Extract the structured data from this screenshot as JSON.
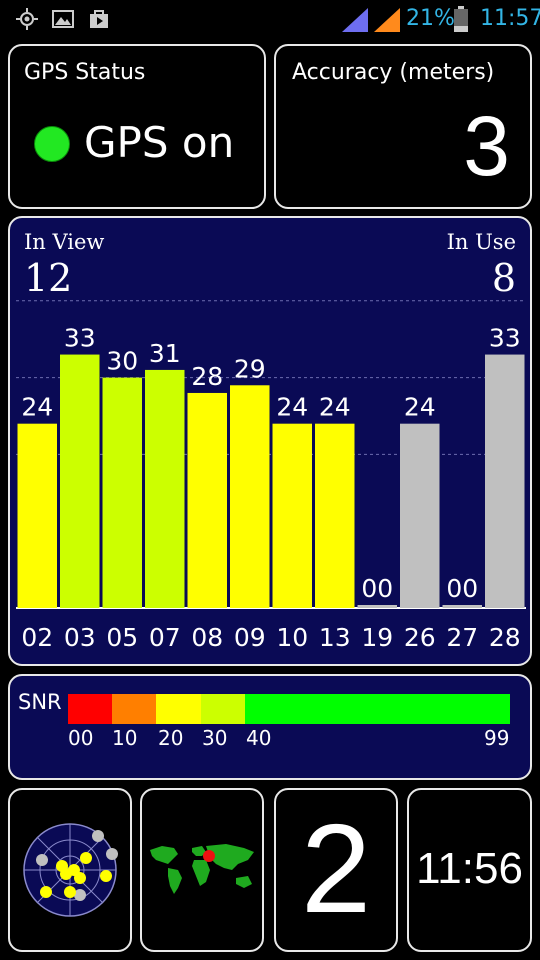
{
  "status_bar": {
    "battery_percent": "21%",
    "time": "11:57",
    "icons": [
      "gps-target-icon",
      "image-icon",
      "shopping-bag-icon",
      "signal-bars-icon",
      "signal-bars-icon",
      "battery-icon"
    ],
    "accent_color": "#33b5e5"
  },
  "gps_status": {
    "title": "GPS Status",
    "state": "GPS on",
    "indicator_color": "#22e822"
  },
  "accuracy": {
    "title": "Accuracy (meters)",
    "value": "3"
  },
  "satellites": {
    "in_view_label": "In View",
    "in_view_value": "12",
    "in_use_label": "In Use",
    "in_use_value": "8"
  },
  "chart_data": {
    "type": "bar",
    "categories": [
      "02",
      "03",
      "05",
      "07",
      "08",
      "09",
      "10",
      "13",
      "19",
      "26",
      "27",
      "28"
    ],
    "values": [
      24,
      33,
      30,
      31,
      28,
      29,
      24,
      24,
      0,
      24,
      0,
      33
    ],
    "value_labels": [
      "24",
      "33",
      "30",
      "31",
      "28",
      "29",
      "24",
      "24",
      "00",
      "24",
      "00",
      "33"
    ],
    "used": [
      true,
      true,
      true,
      true,
      true,
      true,
      true,
      true,
      false,
      false,
      false,
      false
    ],
    "ylim": [
      0,
      50
    ],
    "grid": true,
    "colors": {
      "snr_20_30": "#ffff00",
      "snr_30_40": "#ccff00",
      "unused": "#c0c0c0",
      "background": "#0a0a55"
    }
  },
  "snr_scale": {
    "label": "SNR",
    "ticks": [
      "00",
      "10",
      "20",
      "30",
      "40",
      "99"
    ],
    "segments": [
      {
        "from": 0,
        "to": 10,
        "color": "#ff0000"
      },
      {
        "from": 10,
        "to": 20,
        "color": "#ff7f00"
      },
      {
        "from": 20,
        "to": 30,
        "color": "#ffff00"
      },
      {
        "from": 30,
        "to": 40,
        "color": "#ccff00"
      },
      {
        "from": 40,
        "to": 99,
        "color": "#00ff00"
      }
    ]
  },
  "widgets": {
    "radar_icon": "satellite-radar-icon",
    "map_icon": "world-map-icon",
    "big_number": "2",
    "time": "11:56"
  }
}
